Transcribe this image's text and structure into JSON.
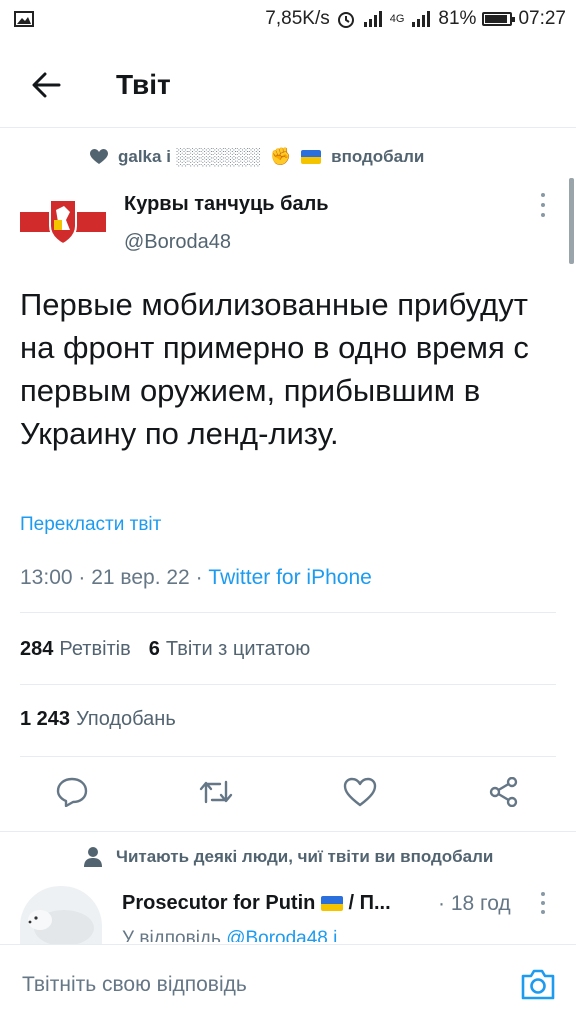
{
  "status_bar": {
    "speed": "7,85K/s",
    "network": "4G",
    "battery_percent_label": "81%",
    "battery_level": 0.81,
    "time": "07:27"
  },
  "header": {
    "title": "Твіт"
  },
  "liked_by": {
    "user": "galka i ░░░░░░░",
    "suffix": "вподобали"
  },
  "tweet": {
    "author_name": "Курвы танчуць баль",
    "author_handle": "@Boroda48",
    "text": "Первые мобилизованные прибудут на фронт примерно в одно время с первым оружием, прибывшим в Украину по ленд-лизу.",
    "translate_label": "Перекласти твіт",
    "time": "13:00",
    "date": "21 вер. 22",
    "source": "Twitter for iPhone",
    "retweets_count": "284",
    "retweets_label": "Ретвітів",
    "quotes_count": "6",
    "quotes_label": "Твіти з цитатою",
    "likes_count": "1 243",
    "likes_label": "Уподобань"
  },
  "replies": {
    "note": "Читають деякі люди, чиї твіти ви вподобали",
    "first": {
      "name": "Prosecutor for Putin",
      "name_suffix": "/ П...",
      "time": "18 год",
      "sub_prefix": "У відповідь",
      "sub_mention": "@Boroda48 і"
    }
  },
  "compose": {
    "placeholder": "Твітніть свою відповідь"
  },
  "colors": {
    "accent": "#1d9bf0",
    "secondary_text": "#536471",
    "divider": "#e6ecf0"
  },
  "icons": [
    "back-arrow-icon",
    "heart-icon",
    "reply-icon",
    "retweet-icon",
    "like-icon",
    "share-icon",
    "person-icon",
    "camera-icon"
  ]
}
